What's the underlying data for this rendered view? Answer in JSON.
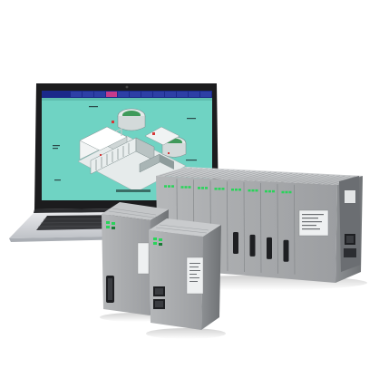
{
  "scene": {
    "laptop": {
      "screen_menu_items": [
        "",
        "",
        "",
        "",
        "",
        "",
        "",
        "",
        "",
        "",
        "",
        ""
      ],
      "screen_header_left": "",
      "screen_footer_caption": "",
      "brand_label": "",
      "colors": {
        "screen_bg": "#6fd3c3",
        "menubar_bg": "#1b2a8a",
        "menu_active": "#c43b8c",
        "body_silver": "#d9dbdf",
        "bezel": "#1c1c1e"
      }
    },
    "modules": {
      "rack_side_label": "",
      "colors": {
        "module_grey": "#a9abad",
        "module_dark": "#7e8184",
        "led_green": "#29d45a",
        "connector_black": "#1e1f22"
      }
    }
  }
}
